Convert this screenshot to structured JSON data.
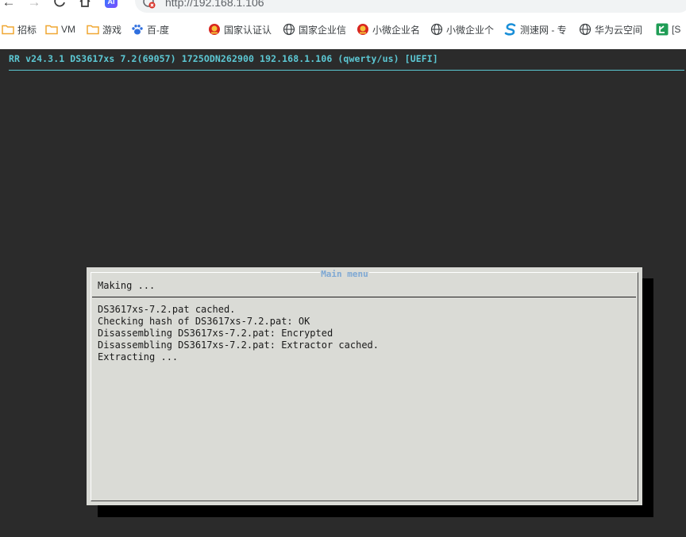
{
  "browser": {
    "url": "http://192.168.1.106",
    "ai_badge": "AI",
    "bookmarks": [
      {
        "label": "招标",
        "icon": "folder-icon"
      },
      {
        "label": "VM",
        "icon": "folder-icon"
      },
      {
        "label": "游戏",
        "icon": "folder-icon"
      },
      {
        "label": "百-度",
        "icon": "baidu-paw-icon"
      },
      {
        "label": "国家认证认",
        "icon": "national-emblem-icon"
      },
      {
        "label": "国家企业信",
        "icon": "globe-icon"
      },
      {
        "label": "小微企业名",
        "icon": "national-emblem-icon"
      },
      {
        "label": "小微企业个",
        "icon": "globe-icon"
      },
      {
        "label": "测速网 - 专",
        "icon": "speedtest-icon"
      },
      {
        "label": "华为云空间",
        "icon": "globe-icon"
      },
      {
        "label": "[S",
        "icon": "green-app-icon"
      }
    ],
    "colors": {
      "folder": "#f0a732",
      "baidu": "#2f6fde",
      "emblem_red": "#d8261f",
      "emblem_gold": "#f5c23a",
      "speedtest": "#1a8fd8",
      "green_app": "#1f9d55"
    }
  },
  "console": {
    "header": "RR v24.3.1 DS3617xs 7.2(69057) 1725ODN262900 192.168.1.106 (qwerty/us) [UEFI]",
    "colors": {
      "background": "#2b2b2b",
      "header_text": "#5cc8d4",
      "dialog_bg": "#dadbd6",
      "dialog_title": "#7ea8d4"
    }
  },
  "dialog": {
    "title": "Main menu",
    "prompt": "Making ...",
    "log": [
      "DS3617xs-7.2.pat cached.",
      "Checking hash of DS3617xs-7.2.pat: OK",
      "Disassembling DS3617xs-7.2.pat: Encrypted",
      "Disassembling DS3617xs-7.2.pat: Extractor cached.",
      "Extracting ..."
    ]
  }
}
